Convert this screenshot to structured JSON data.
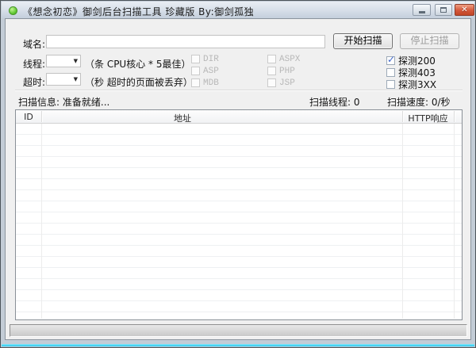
{
  "window": {
    "title": "《想念初恋》御剑后台扫描工具 珍藏版 By:御剑孤独"
  },
  "icons": {
    "app_icon": "green-circle",
    "minimize_icon": "dash",
    "maximize_icon": "square",
    "close_icon": "✕",
    "combo_arrow_icon": "▼",
    "check_icon": "✓"
  },
  "scan_bar": {
    "domain_label": "域名:",
    "domain_value": "",
    "start_button": "开始扫描",
    "stop_button": "停止扫描"
  },
  "options": {
    "threads_label": "线程:",
    "threads_value": "",
    "threads_hint": "（条 CPU核心 * 5最佳）",
    "timeout_label": "超时:",
    "timeout_value": "",
    "timeout_hint": "（秒 超时的页面被丢弃）",
    "extensions": [
      {
        "label": "DIR",
        "checked": false,
        "enabled": false
      },
      {
        "label": "ASP",
        "checked": false,
        "enabled": false
      },
      {
        "label": "MDB",
        "checked": false,
        "enabled": false
      },
      {
        "label": "ASPX",
        "checked": false,
        "enabled": false
      },
      {
        "label": "PHP",
        "checked": false,
        "enabled": false
      },
      {
        "label": "JSP",
        "checked": false,
        "enabled": false
      }
    ],
    "probes": [
      {
        "label": "探测200",
        "checked": true,
        "enabled": true
      },
      {
        "label": "探测403",
        "checked": false,
        "enabled": true
      },
      {
        "label": "探测3XX",
        "checked": false,
        "enabled": true
      }
    ]
  },
  "status": {
    "info_label": "扫描信息:",
    "info_value": "准备就绪...",
    "threads_label": "扫描线程:",
    "threads_value": "0",
    "speed_label": "扫描速度:",
    "speed_value": "0/秒"
  },
  "table": {
    "columns": [
      "ID",
      "地址",
      "HTTP响应"
    ],
    "rows": []
  },
  "colors": {
    "titlebar_top": "#e9eef4",
    "titlebar_bottom": "#c4cfdc",
    "frame": "#c3ccd6",
    "content_bg": "#f0f0f0",
    "close_button_red": "#d4573a",
    "app_icon_green": "#62ca35",
    "probe_check_blue": "#3f67cc",
    "bottom_glow_cyan": "#1fc6ee"
  }
}
